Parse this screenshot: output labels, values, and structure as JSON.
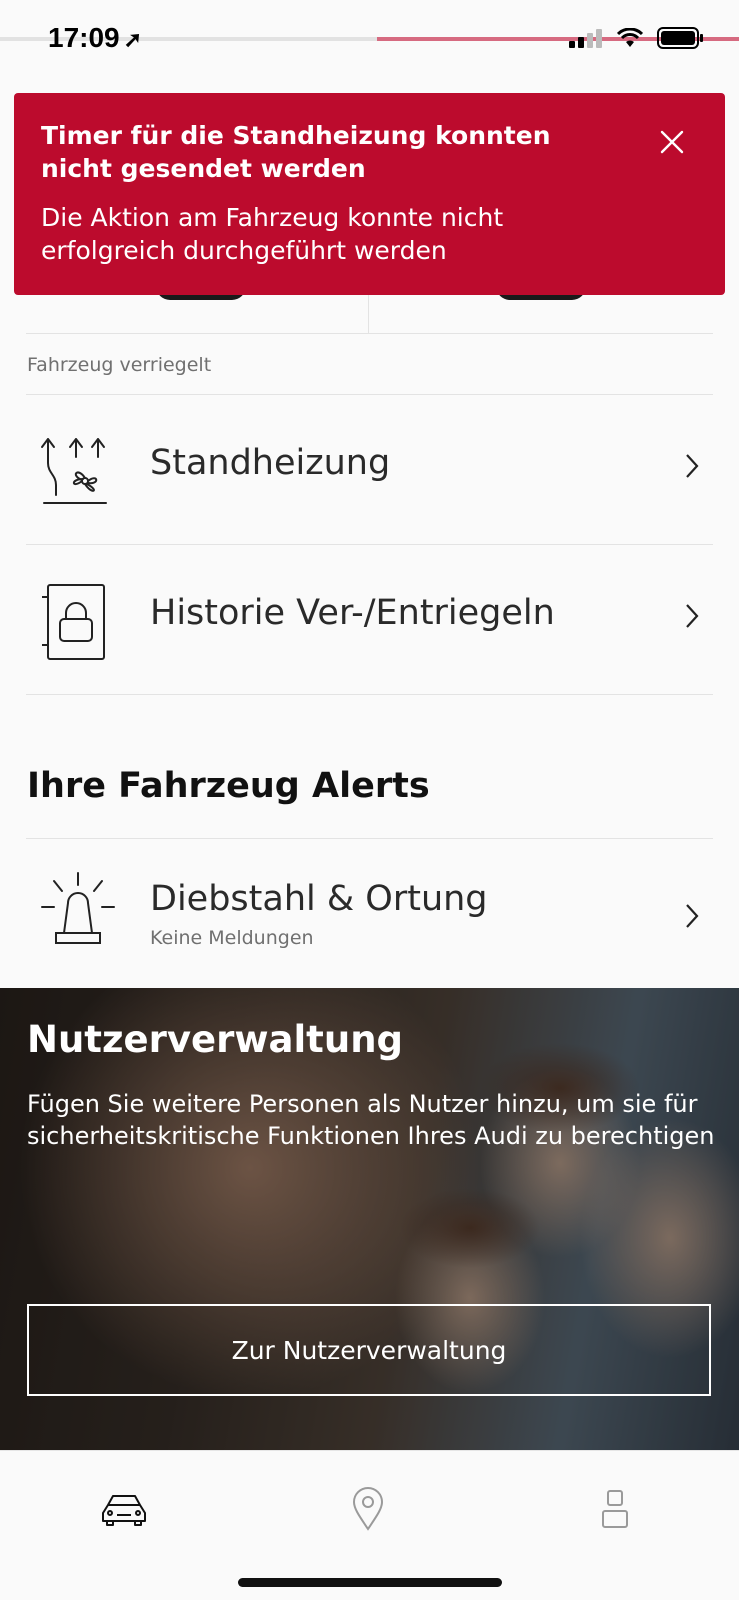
{
  "status_bar": {
    "time": "17:09",
    "location_arrow": "➚"
  },
  "toast": {
    "title": "Timer für die Standheizung konnten nicht gesendet werden",
    "message": "Die Aktion am Fahrzeug konnte nicht erfolgreich durchgeführt werden",
    "close_icon": "close-icon",
    "color": "#bc0b2d"
  },
  "vehicle": {
    "lock_status": "Fahrzeug verriegelt"
  },
  "menu": [
    {
      "label": "Standheizung",
      "icon": "auxiliary-heating-icon"
    },
    {
      "label": "Historie Ver-/Entriegeln",
      "icon": "lock-history-icon"
    }
  ],
  "alerts": {
    "title": "Ihre Fahrzeug Alerts",
    "items": [
      {
        "label": "Diebstahl & Ortung",
        "sub": "Keine Meldungen",
        "icon": "alarm-light-icon"
      }
    ]
  },
  "promo": {
    "title": "Nutzerverwaltung",
    "text": "Fügen Sie weitere Personen als Nutzer hinzu, um sie für sicherheitskritische Funktionen Ihres Audi zu berechtigen",
    "button_label": "Zur Nutzerverwaltung"
  },
  "bottom_nav": [
    {
      "icon": "car-icon",
      "active": true
    },
    {
      "icon": "location-pin-icon",
      "active": false
    },
    {
      "icon": "user-icon",
      "active": false
    }
  ]
}
